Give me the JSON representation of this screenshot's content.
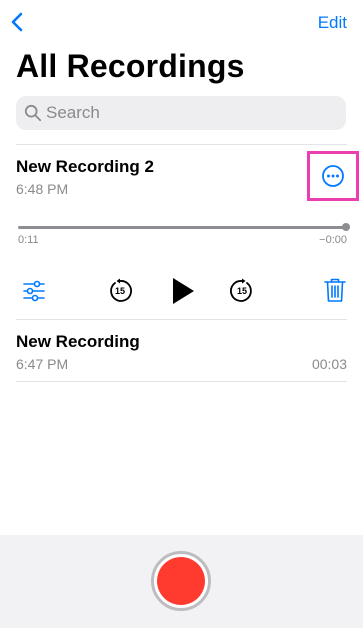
{
  "nav": {
    "edit_label": "Edit"
  },
  "page_title": "All Recordings",
  "search": {
    "placeholder": "Search"
  },
  "recordings": [
    {
      "name": "New Recording 2",
      "time": "6:48 PM",
      "elapsed": "0:11",
      "remaining": "−0:00"
    },
    {
      "name": "New Recording",
      "time": "6:47 PM",
      "duration": "00:03"
    }
  ],
  "player": {
    "skip_back_seconds": "15",
    "skip_forward_seconds": "15",
    "progress": 1.0
  },
  "colors": {
    "accent": "#007aff",
    "record": "#ff3b30",
    "highlight": "#ea3fb0"
  },
  "icons": [
    "chevron-left-icon",
    "search-icon",
    "ellipsis-circle-icon",
    "sliders-icon",
    "skip-back-15-icon",
    "play-icon",
    "skip-forward-15-icon",
    "trash-icon",
    "record-icon"
  ]
}
